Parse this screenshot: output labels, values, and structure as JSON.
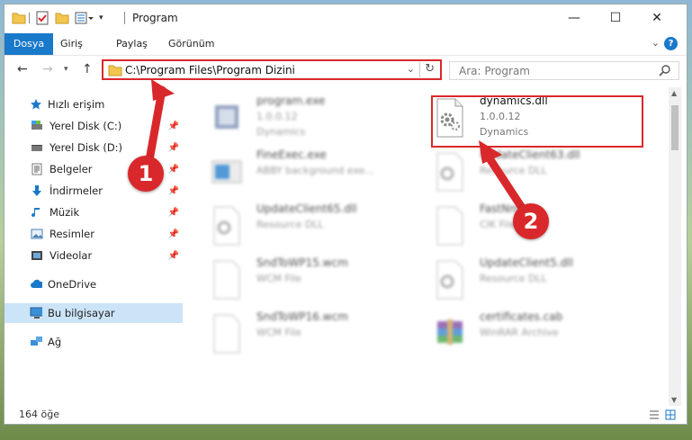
{
  "window": {
    "title": "Program"
  },
  "ribbon": {
    "tabs": [
      "Dosya",
      "Giriş",
      "Paylaş",
      "Görünüm"
    ]
  },
  "address": {
    "path": "C:\\Program Files\\Program Dizini"
  },
  "search": {
    "placeholder": "Ara: Program"
  },
  "sidebar": {
    "items": [
      {
        "label": "Hızlı erişim",
        "icon": "star-icon"
      },
      {
        "label": "Yerel Disk (C:)",
        "icon": "drive-icon",
        "pinned": true
      },
      {
        "label": "Yerel Disk (D:)",
        "icon": "drive-icon",
        "pinned": true
      },
      {
        "label": "Belgeler",
        "icon": "documents-icon",
        "pinned": true
      },
      {
        "label": "İndirmeler",
        "icon": "download-icon",
        "pinned": true
      },
      {
        "label": "Müzik",
        "icon": "music-icon",
        "pinned": true
      },
      {
        "label": "Resimler",
        "icon": "pictures-icon",
        "pinned": true
      },
      {
        "label": "Videolar",
        "icon": "videos-icon",
        "pinned": true
      },
      {
        "label": "OneDrive",
        "icon": "cloud-icon"
      },
      {
        "label": "Bu bilgisayar",
        "icon": "computer-icon",
        "selected": true
      },
      {
        "label": "Ağ",
        "icon": "network-icon"
      }
    ]
  },
  "files": [
    {
      "name": "program.exe",
      "line2": "1.0.0.12",
      "line3": "Dynamics",
      "icon": "exe-icon"
    },
    {
      "name": "dynamics.dll",
      "line2": "1.0.0.12",
      "line3": "Dynamics",
      "icon": "dll-gear-icon",
      "highlighted": true
    },
    {
      "name": "FineExec.exe",
      "line2": "ABBY background exe...",
      "line3": "",
      "icon": "exe-window-icon"
    },
    {
      "name": "UpdateClient63.dll",
      "line2": "Resource DLL",
      "line3": "",
      "icon": "dll-gear-icon"
    },
    {
      "name": "UpdateClient65.dll",
      "line2": "Resource DLL",
      "line3": "",
      "icon": "dll-gear-icon"
    },
    {
      "name": "FastNm...",
      "line2": "CIK File",
      "line3": "",
      "icon": "file-icon"
    },
    {
      "name": "SndToWP15.wcm",
      "line2": "WCM File",
      "line3": "",
      "icon": "file-icon"
    },
    {
      "name": "UpdateClient5.dll",
      "line2": "Resource DLL",
      "line3": "",
      "icon": "dll-gear-icon"
    },
    {
      "name": "SndToWP16.wcm",
      "line2": "WCM File",
      "line3": "",
      "icon": "file-icon"
    },
    {
      "name": "certificates.cab",
      "line2": "WinRAR Archive",
      "line3": "",
      "icon": "winrar-icon"
    }
  ],
  "status": {
    "count": "164 öğe"
  },
  "callouts": [
    "1",
    "2"
  ],
  "colors": {
    "accent": "#1979ca",
    "highlight": "#d9282b"
  }
}
